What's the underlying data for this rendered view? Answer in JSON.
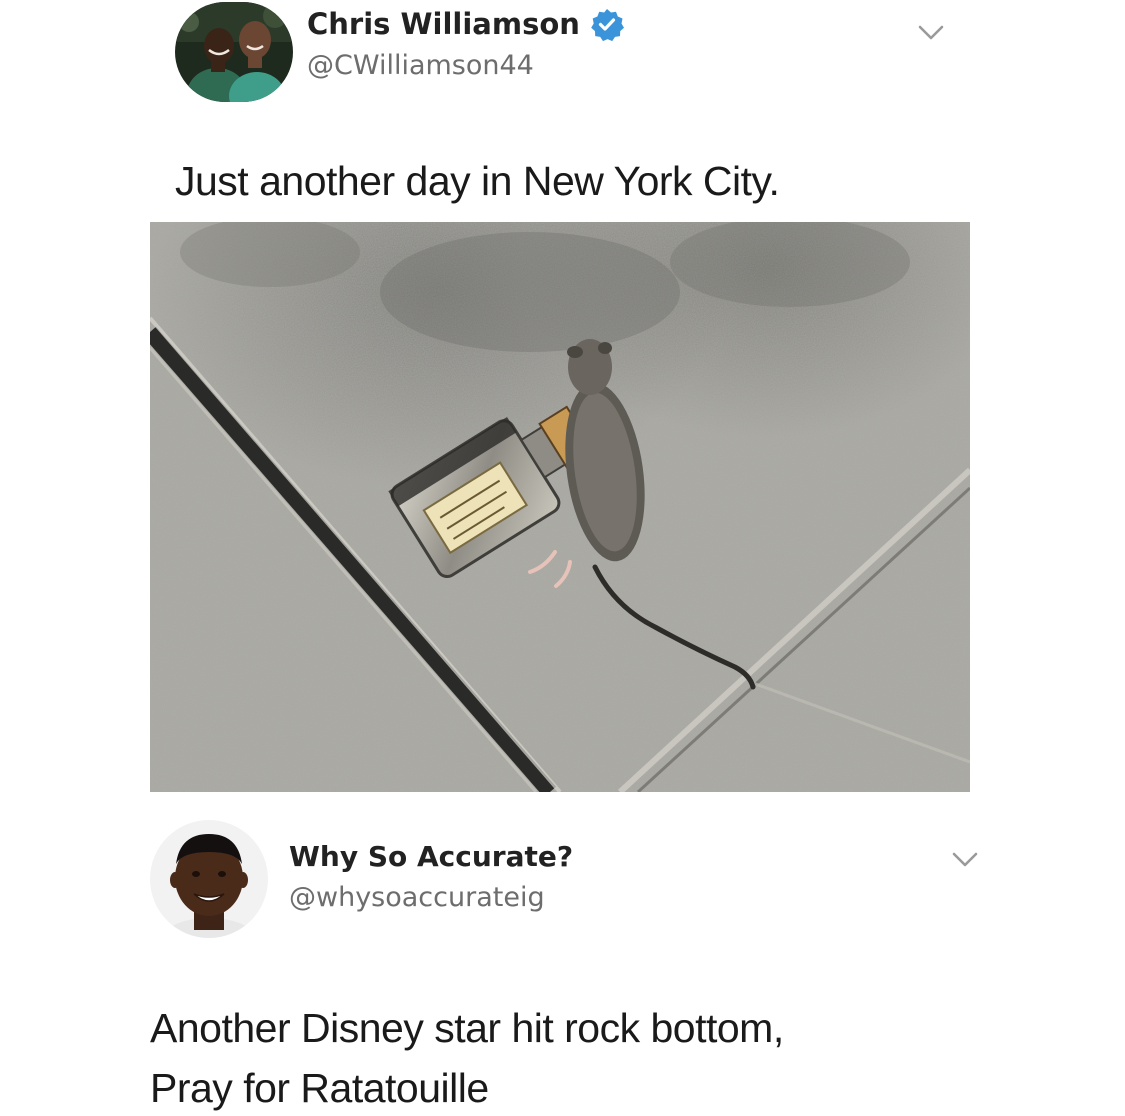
{
  "tweets": [
    {
      "author_name": "Chris Williamson",
      "handle": "@CWilliamson44",
      "verified": true,
      "text": "Just another day in New York City.",
      "media": "photo of a rat lying next to a small liquor bottle on a sidewalk"
    },
    {
      "author_name": "Why So Accurate?",
      "handle": "@whysoaccurateig",
      "verified": false,
      "text_lines": [
        "Another Disney star hit rock bottom,",
        "Pray for Ratatouille"
      ]
    }
  ],
  "icons": {
    "verified": "verified-badge-icon",
    "menu": "chevron-down-icon"
  },
  "colors": {
    "verified_blue": "#3b94d9",
    "name_text": "#222222",
    "handle_text": "#6d6d6d",
    "body_text": "#1a1a1a",
    "chevron": "#9a9a9a",
    "background": "#ffffff"
  }
}
